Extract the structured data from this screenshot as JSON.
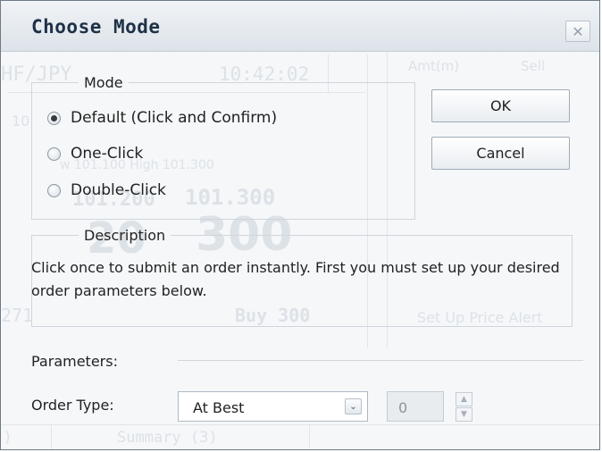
{
  "dialog": {
    "title": "Choose Mode",
    "close_glyph": "✕"
  },
  "background_ghost": {
    "pair": "HF/JPY",
    "time": "10:42:02",
    "amount": "10",
    "low_high": "w 101.100 High 101.300",
    "price_left": "101.200",
    "price_right": "101.300",
    "big_left": "20",
    "big_right": "300",
    "qty": "271",
    "buy": "Buy 300",
    "amt_col": "Amt(m)",
    "sell_col": "Sell",
    "alert": "Set Up Price Alert",
    "summary": "Summary (3)",
    "left_tab": ")"
  },
  "mode_group": {
    "legend": "Mode",
    "options": [
      {
        "label": "Default (Click and Confirm)",
        "checked": true
      },
      {
        "label": "One-Click",
        "checked": false
      },
      {
        "label": "Double-Click",
        "checked": false
      }
    ]
  },
  "buttons": {
    "ok": "OK",
    "cancel": "Cancel"
  },
  "description_group": {
    "legend": "Description",
    "text": "Click once to submit an order instantly. First you must set up your desired order parameters below."
  },
  "parameters": {
    "label": "Parameters:",
    "order_type_label": "Order Type:",
    "order_type_value": "At Best",
    "dropdown_arrow": "⌄",
    "quantity_value": "0",
    "spin_up": "▲",
    "spin_down": "▼"
  }
}
